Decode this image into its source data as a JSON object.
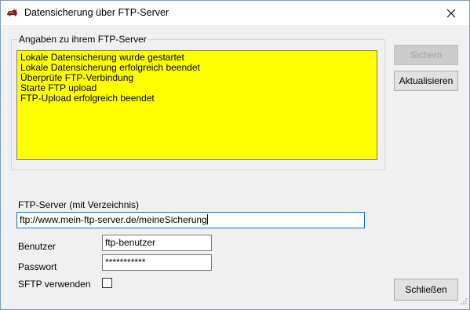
{
  "window": {
    "title": "Datensicherung über FTP-Server",
    "icon": "cat-app-icon"
  },
  "group": {
    "legend": "Angaben zu ihrem FTP-Server",
    "log_lines": [
      "Lokale Datensicherung wurde gestartet",
      "Lokale Datensicherung erfolgreich beendet",
      "Überprüfe FTP-Verbindung",
      "Starte FTP upload",
      "FTP-Upload erfolgreich beendet"
    ],
    "log_background": "#ffff00"
  },
  "buttons": {
    "sichern": "Sichern",
    "aktualisieren": "Aktualisieren",
    "schliessen": "Schließen"
  },
  "form": {
    "server_label": "FTP-Server (mit Verzeichnis)",
    "server_value": "ftp://www.mein-ftp-server.de/meineSicherung",
    "user_label": "Benutzer",
    "user_value": "ftp-benutzer",
    "password_label": "Passwort",
    "password_value": "***********",
    "sftp_label": "SFTP verwenden",
    "sftp_checked": false
  }
}
